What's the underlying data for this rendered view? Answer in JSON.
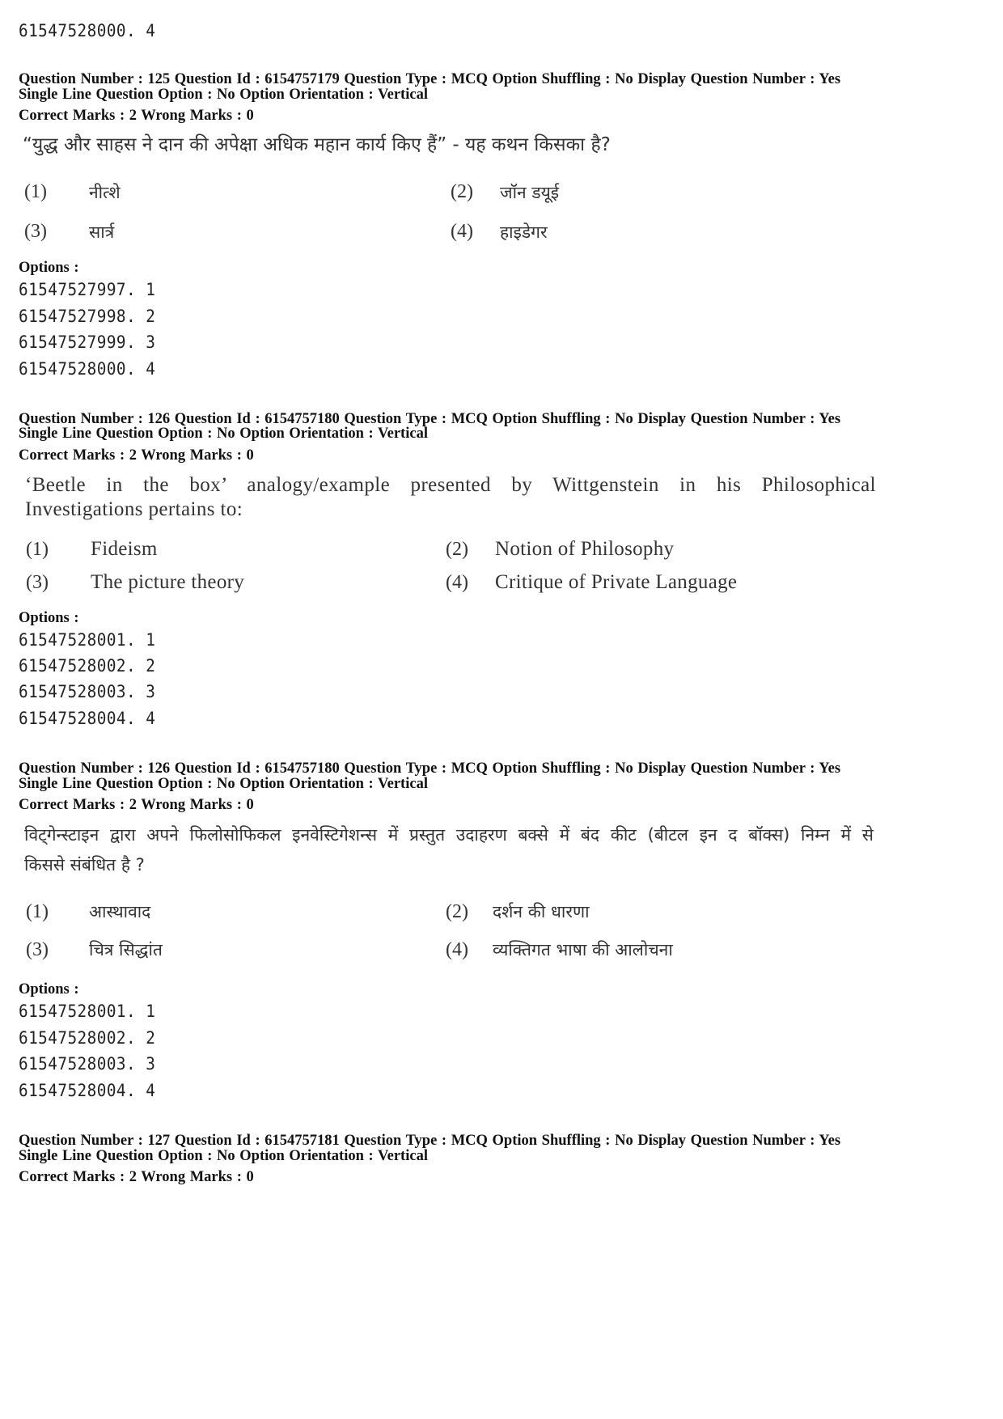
{
  "top_option": "61547528000. 4",
  "questions": [
    {
      "meta_line1": "Question Number : 125  Question Id : 6154757179  Question Type : MCQ  Option Shuffling : No  Display Question Number : Yes",
      "meta_line2": "Single Line Question Option : No  Option Orientation : Vertical",
      "marks": "Correct Marks : 2  Wrong Marks : 0",
      "text": "“युद्ध और साहस ने दान की अपेक्षा अधिक महान कार्य किए हैं” - यह कथन किसका है?",
      "choices": [
        {
          "num": "(1)",
          "label": "नीत्शे"
        },
        {
          "num": "(2)",
          "label": "जॉन डयूई"
        },
        {
          "num": "(3)",
          "label": "सार्त्र"
        },
        {
          "num": "(4)",
          "label": "हाइडेगर"
        }
      ],
      "options_label": "Options :",
      "option_ids": [
        "61547527997. 1",
        "61547527998. 2",
        "61547527999. 3",
        "61547528000. 4"
      ]
    },
    {
      "meta_line1": "Question Number : 126  Question Id : 6154757180  Question Type : MCQ  Option Shuffling : No  Display Question Number : Yes",
      "meta_line2": "Single Line Question Option : No  Option Orientation : Vertical",
      "marks": "Correct Marks : 2  Wrong Marks : 0",
      "text_line1": "‘Beetle in the box’ analogy/example presented by Wittgenstein in his Philosophical",
      "text_line2": "Investigations pertains to:",
      "choices": [
        {
          "num": "(1)",
          "label": "Fideism"
        },
        {
          "num": "(2)",
          "label": "Notion of Philosophy"
        },
        {
          "num": "(3)",
          "label": "The picture theory"
        },
        {
          "num": "(4)",
          "label": "Critique of Private Language"
        }
      ],
      "options_label": "Options :",
      "option_ids": [
        "61547528001. 1",
        "61547528002. 2",
        "61547528003. 3",
        "61547528004. 4"
      ]
    },
    {
      "meta_line1": "Question Number : 126  Question Id : 6154757180  Question Type : MCQ  Option Shuffling : No  Display Question Number : Yes",
      "meta_line2": "Single Line Question Option : No  Option Orientation : Vertical",
      "marks": "Correct Marks : 2  Wrong Marks : 0",
      "text_line1": "विट्गेन्स्टाइन द्वारा अपने फिलोसोफिकल इनवेस्टिगेशन्स में प्रस्तुत उदाहरण बक्से में बंद कीट (बीटल इन द बॉक्स) निम्न में से",
      "text_line2": "किससे संबंधित है ?",
      "choices": [
        {
          "num": "(1)",
          "label": "आस्थावाद"
        },
        {
          "num": "(2)",
          "label": "दर्शन की धारणा"
        },
        {
          "num": "(3)",
          "label": "चित्र सिद्धांत"
        },
        {
          "num": "(4)",
          "label": "व्यक्तिगत भाषा की आलोचना"
        }
      ],
      "options_label": "Options :",
      "option_ids": [
        "61547528001. 1",
        "61547528002. 2",
        "61547528003. 3",
        "61547528004. 4"
      ]
    },
    {
      "meta_line1": "Question Number : 127  Question Id : 6154757181  Question Type : MCQ  Option Shuffling : No  Display Question Number : Yes",
      "meta_line2": "Single Line Question Option : No  Option Orientation : Vertical",
      "marks": "Correct Marks : 2  Wrong Marks : 0"
    }
  ]
}
